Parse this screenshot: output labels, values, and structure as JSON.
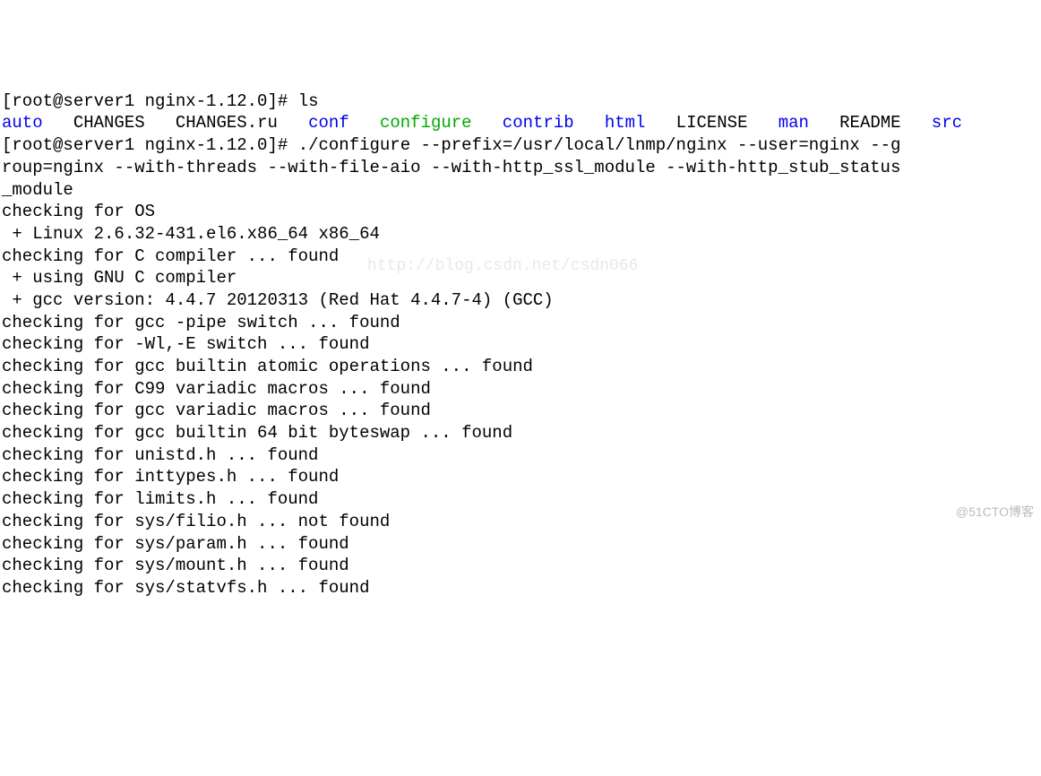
{
  "prompt1": {
    "prefix": "[",
    "user_host": "root@server1",
    "path": " nginx-1.12.0",
    "suffix": "]# ",
    "command": "ls"
  },
  "ls_output": {
    "f1": "auto",
    "f2": "CHANGES",
    "f3": "CHANGES.ru",
    "f4": "conf",
    "f5": "configure",
    "f6": "contrib",
    "f7": "html",
    "f8": "LICENSE",
    "f9": "man",
    "f10": "README",
    "f11": "src"
  },
  "prompt2": {
    "prefix": "[",
    "user_host": "root@server1",
    "path": " nginx-1.12.0",
    "suffix": "]# ",
    "command_l1": "./configure --prefix=/usr/local/lnmp/nginx --user=nginx --g",
    "command_l2": "roup=nginx --with-threads --with-file-aio --with-http_ssl_module --with-http_stub_status",
    "command_l3": "_module"
  },
  "output_lines": [
    "checking for OS",
    " + Linux 2.6.32-431.el6.x86_64 x86_64",
    "checking for C compiler ... found",
    " + using GNU C compiler",
    " + gcc version: 4.4.7 20120313 (Red Hat 4.4.7-4) (GCC)",
    "checking for gcc -pipe switch ... found",
    "checking for -Wl,-E switch ... found",
    "checking for gcc builtin atomic operations ... found",
    "checking for C99 variadic macros ... found",
    "checking for gcc variadic macros ... found",
    "checking for gcc builtin 64 bit byteswap ... found",
    "checking for unistd.h ... found",
    "checking for inttypes.h ... found",
    "checking for limits.h ... found",
    "checking for sys/filio.h ... not found",
    "checking for sys/param.h ... found",
    "checking for sys/mount.h ... found",
    "checking for sys/statvfs.h ... found"
  ],
  "watermark_faint": "http://blog.csdn.net/csdn066",
  "watermark_corner": "@51CTO博客"
}
